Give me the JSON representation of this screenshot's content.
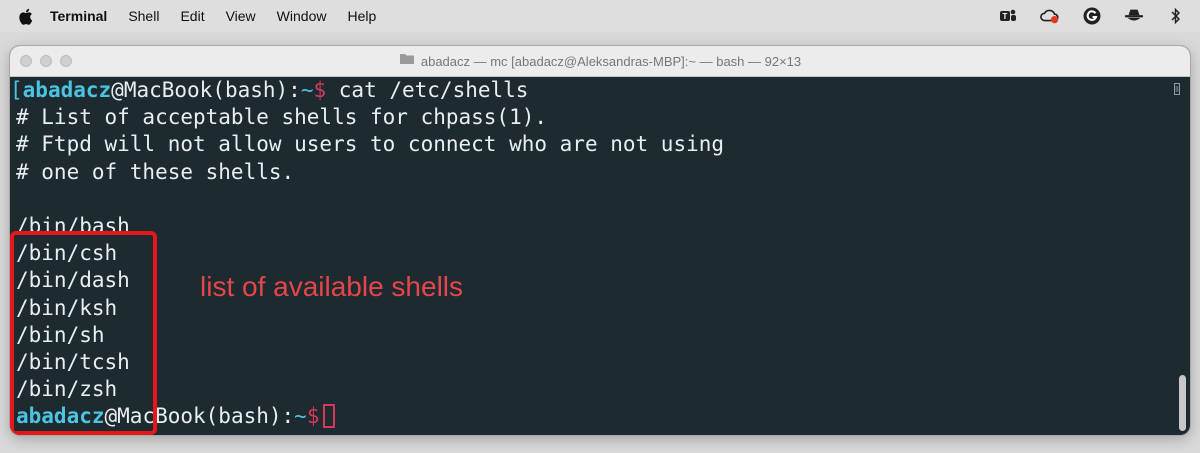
{
  "menubar": {
    "app_name": "Terminal",
    "menus": [
      "Shell",
      "Edit",
      "View",
      "Window",
      "Help"
    ],
    "tray_icons": [
      "teams-icon",
      "cloud-sync-icon",
      "grammarly-icon",
      "incognito-icon",
      "bluetooth-icon"
    ]
  },
  "window": {
    "title": "abadacz — mc [abadacz@Aleksandras-MBP]:~ — bash — 92×13",
    "background": "#1d2a30"
  },
  "terminal": {
    "prompt": {
      "user": "abadacz",
      "host": "@MacBook(bash):",
      "path": "~",
      "symbol": "$"
    },
    "command": " cat /etc/shells",
    "output_comments": [
      "# List of acceptable shells for chpass(1).",
      "# Ftpd will not allow users to connect who are not using",
      "# one of these shells."
    ],
    "shells": [
      "/bin/bash",
      "/bin/csh",
      "/bin/dash",
      "/bin/ksh",
      "/bin/sh",
      "/bin/tcsh",
      "/bin/zsh"
    ]
  },
  "annotation": {
    "label": "list of available shells",
    "color": "#e5171b"
  }
}
